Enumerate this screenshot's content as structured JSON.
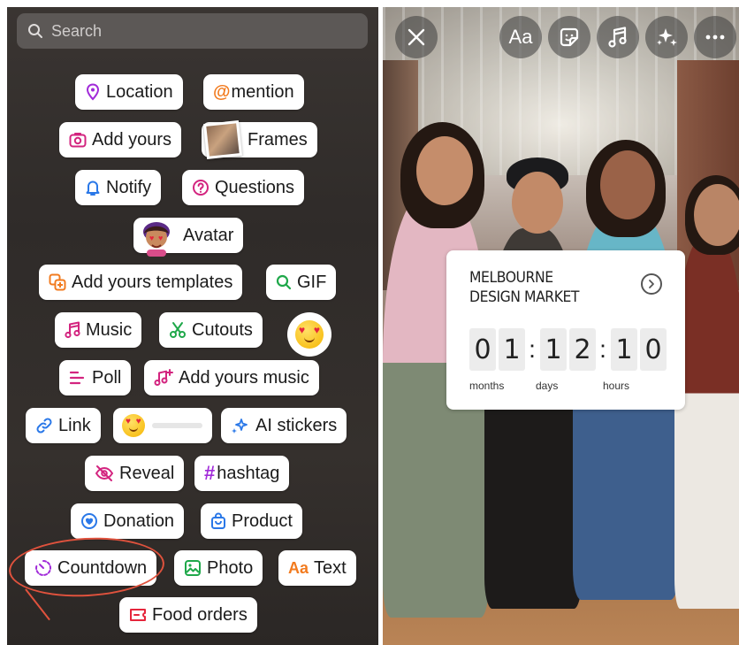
{
  "left_panel": {
    "search": {
      "placeholder": "Search"
    },
    "stickers": {
      "location": "Location",
      "mention": "mention",
      "add_yours": "Add yours",
      "frames": "Frames",
      "notify": "Notify",
      "questions": "Questions",
      "avatar": "Avatar",
      "add_yours_templates": "Add yours templates",
      "gif": "GIF",
      "music": "Music",
      "cutouts": "Cutouts",
      "poll": "Poll",
      "add_yours_music": "Add yours music",
      "link": "Link",
      "ai_stickers": "AI stickers",
      "reveal": "Reveal",
      "hashtag": "hashtag",
      "donation": "Donation",
      "product": "Product",
      "countdown": "Countdown",
      "photo": "Photo",
      "text": "Text",
      "text_icon": "Aa",
      "food_orders": "Food orders"
    },
    "colors": {
      "purple": "#a12bd9",
      "pink": "#d3247f",
      "orange": "#f27b1f",
      "green": "#1fa84a",
      "blue": "#2a78e8",
      "red_annotation": "#e0523d"
    }
  },
  "right_panel": {
    "top_buttons": {
      "close": "close-icon",
      "text": "Aa",
      "sticker": "sticker-icon",
      "music": "music-icon",
      "effects": "sparkles-icon",
      "more": "more-icon"
    },
    "countdown_sticker": {
      "title": "MELBOURNE DESIGN MARKET",
      "digits": [
        "0",
        "1",
        "1",
        "2",
        "1",
        "0"
      ],
      "labels": {
        "months": "months",
        "days": "days",
        "hours": "hours"
      }
    }
  }
}
